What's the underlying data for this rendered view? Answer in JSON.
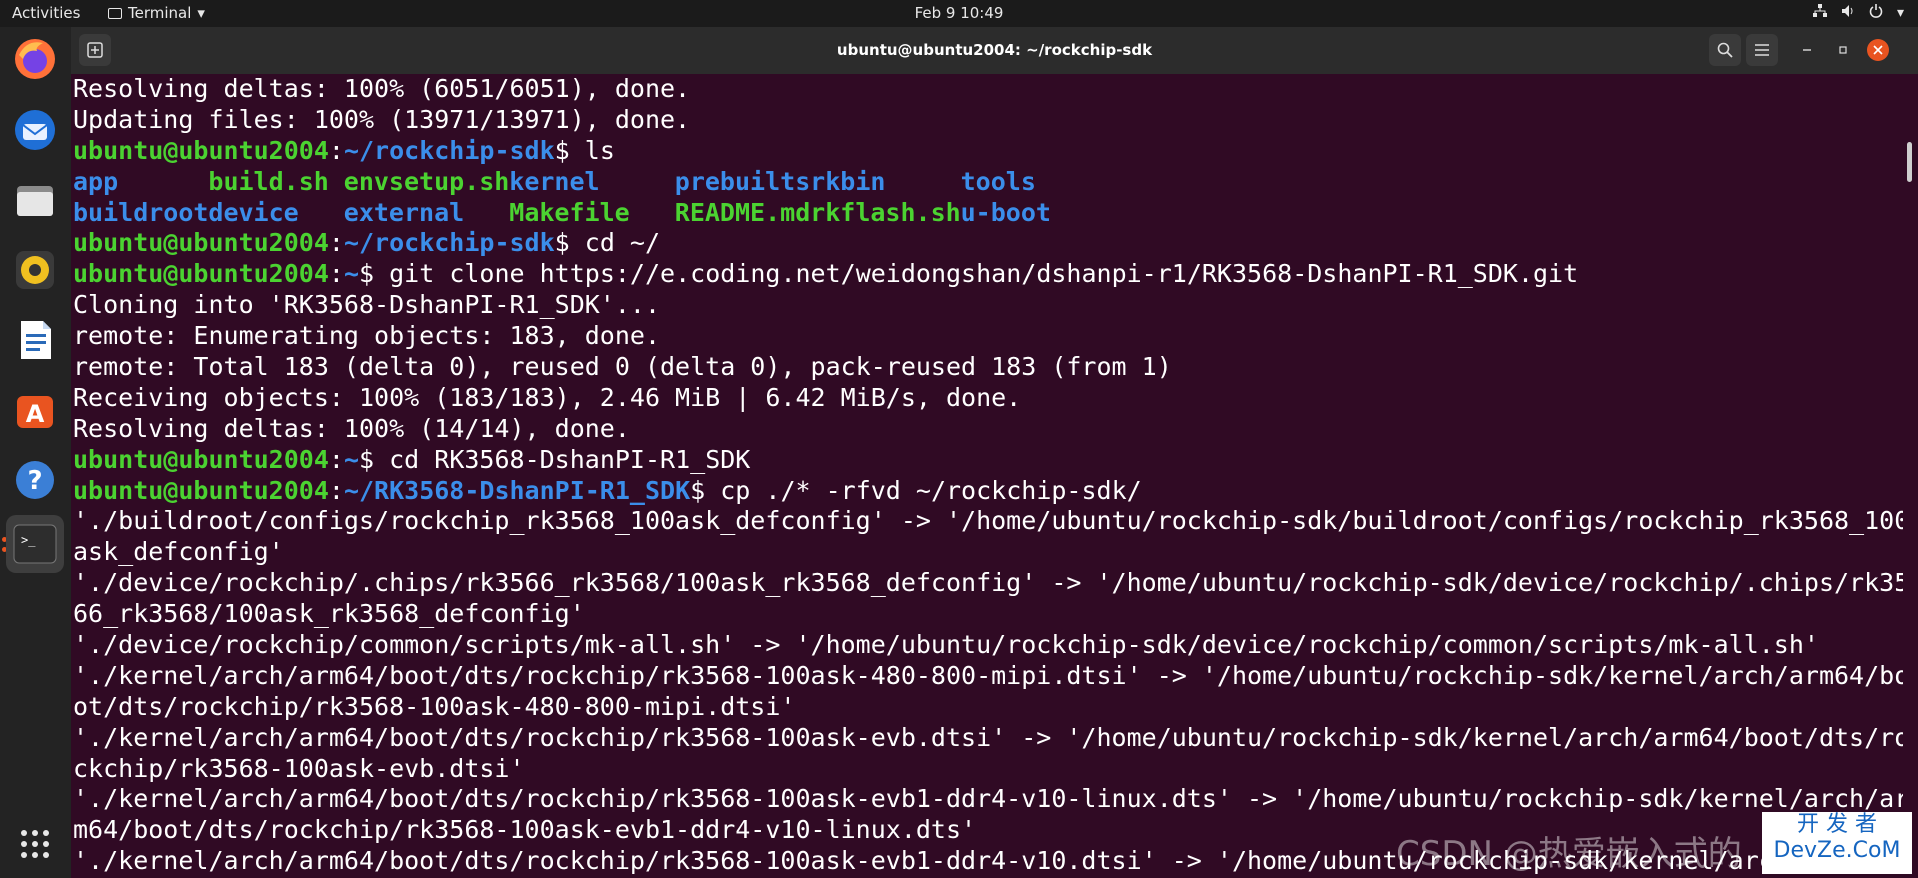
{
  "topbar": {
    "activities": "Activities",
    "app_menu": "Terminal",
    "clock": "Feb 9  10:49"
  },
  "dock": {
    "items": [
      "firefox-icon",
      "thunderbird-icon",
      "files-icon",
      "rhythmbox-icon",
      "libreoffice-writer-icon",
      "app-center-icon",
      "help-icon",
      "terminal-icon"
    ]
  },
  "window": {
    "title": "ubuntu@ubuntu2004: ~/rockchip-sdk"
  },
  "terminal": {
    "lines": [
      {
        "t": "Resolving deltas: 100% (6051/6051), done."
      },
      {
        "t": "Updating files: 100% (13971/13971), done."
      },
      {
        "prompt": {
          "user": "ubuntu@ubuntu2004",
          "path": "~/rockchip-sdk",
          "cmd": " ls"
        }
      },
      {
        "ls": [
          "app",
          "build.sh",
          "envsetup.sh",
          "kernel",
          "prebuilts",
          "rkbin",
          "tools"
        ],
        "kinds": [
          "d",
          "e",
          "e",
          "d",
          "d",
          "d",
          "d"
        ]
      },
      {
        "ls": [
          "buildroot",
          "device",
          "external",
          "Makefile",
          "README.md",
          "rkflash.sh",
          "u-boot"
        ],
        "kinds": [
          "d",
          "d",
          "d",
          "e",
          "e",
          "e",
          "d"
        ]
      },
      {
        "prompt": {
          "user": "ubuntu@ubuntu2004",
          "path": "~/rockchip-sdk",
          "cmd": " cd ~/"
        }
      },
      {
        "prompt": {
          "user": "ubuntu@ubuntu2004",
          "path": "~",
          "cmd": " git clone https://e.coding.net/weidongshan/dshanpi-r1/RK3568-DshanPI-R1_SDK.git"
        }
      },
      {
        "t": "Cloning into 'RK3568-DshanPI-R1_SDK'..."
      },
      {
        "t": "remote: Enumerating objects: 183, done."
      },
      {
        "t": "remote: Total 183 (delta 0), reused 0 (delta 0), pack-reused 183 (from 1)"
      },
      {
        "t": "Receiving objects: 100% (183/183), 2.46 MiB | 6.42 MiB/s, done."
      },
      {
        "t": "Resolving deltas: 100% (14/14), done."
      },
      {
        "prompt": {
          "user": "ubuntu@ubuntu2004",
          "path": "~",
          "cmd": " cd RK3568-DshanPI-R1_SDK"
        }
      },
      {
        "prompt": {
          "user": "ubuntu@ubuntu2004",
          "path": "~/RK3568-DshanPI-R1_SDK",
          "cmd": " cp ./* -rfvd ~/rockchip-sdk/"
        }
      },
      {
        "t": "'./buildroot/configs/rockchip_rk3568_100ask_defconfig' -> '/home/ubuntu/rockchip-sdk/buildroot/configs/rockchip_rk3568_100"
      },
      {
        "t": "ask_defconfig'"
      },
      {
        "t": "'./device/rockchip/.chips/rk3566_rk3568/100ask_rk3568_defconfig' -> '/home/ubuntu/rockchip-sdk/device/rockchip/.chips/rk35"
      },
      {
        "t": "66_rk3568/100ask_rk3568_defconfig'"
      },
      {
        "t": "'./device/rockchip/common/scripts/mk-all.sh' -> '/home/ubuntu/rockchip-sdk/device/rockchip/common/scripts/mk-all.sh'"
      },
      {
        "t": "'./kernel/arch/arm64/boot/dts/rockchip/rk3568-100ask-480-800-mipi.dtsi' -> '/home/ubuntu/rockchip-sdk/kernel/arch/arm64/bo"
      },
      {
        "t": "ot/dts/rockchip/rk3568-100ask-480-800-mipi.dtsi'"
      },
      {
        "t": "'./kernel/arch/arm64/boot/dts/rockchip/rk3568-100ask-evb.dtsi' -> '/home/ubuntu/rockchip-sdk/kernel/arch/arm64/boot/dts/ro"
      },
      {
        "t": "ckchip/rk3568-100ask-evb.dtsi'"
      },
      {
        "t": "'./kernel/arch/arm64/boot/dts/rockchip/rk3568-100ask-evb1-ddr4-v10-linux.dts' -> '/home/ubuntu/rockchip-sdk/kernel/arch/ar"
      },
      {
        "t": "m64/boot/dts/rockchip/rk3568-100ask-evb1-ddr4-v10-linux.dts'"
      },
      {
        "t": "'./kernel/arch/arm64/boot/dts/rockchip/rk3568-100ask-evb1-ddr4-v10.dtsi' -> '/home/ubuntu/rockchip-sdk/kernel/arch/arm64"
      }
    ]
  },
  "watermark": {
    "text": "CSDN @热爱嵌入式的",
    "logo_line1": "开 发 者",
    "logo_line2": "DevZe.CoM"
  }
}
